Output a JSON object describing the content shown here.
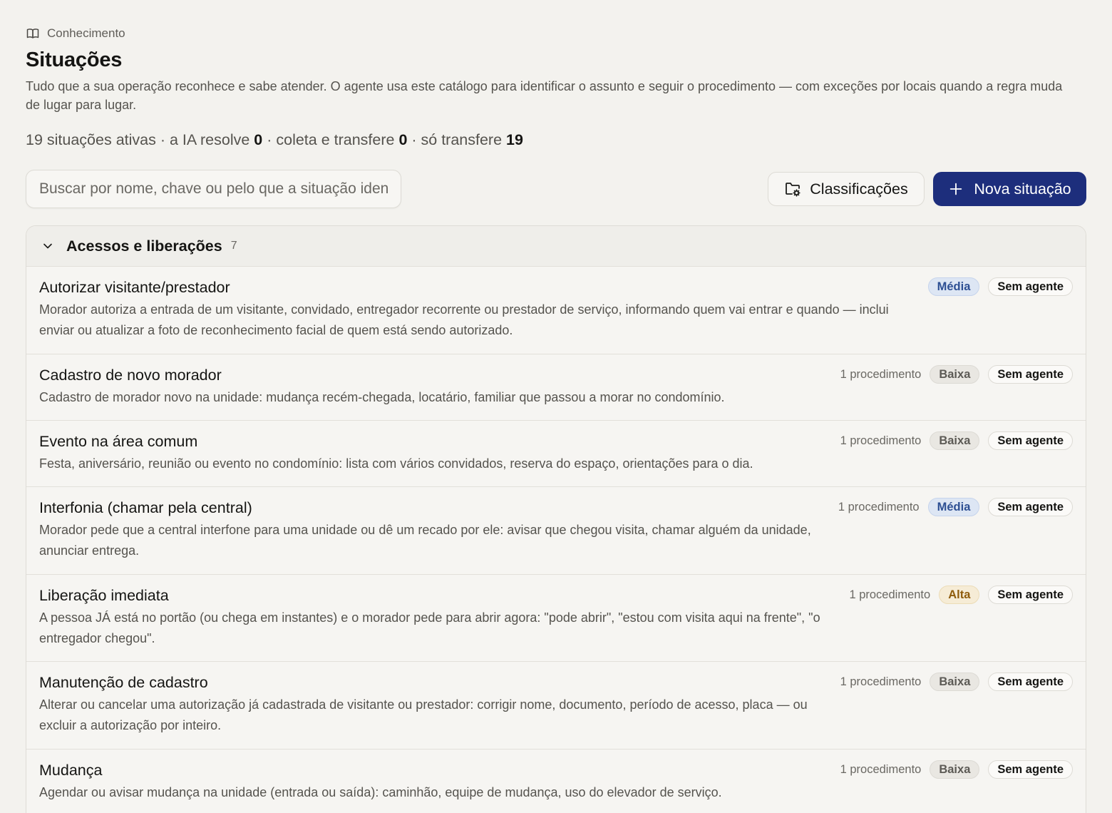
{
  "breadcrumb": {
    "label": "Conhecimento",
    "icon": "book-icon"
  },
  "page": {
    "title": "Situações",
    "description": "Tudo que a sua operação reconhece e sabe atender. O agente usa este catálogo para identificar o assunto e seguir o procedimento — com exceções por locais quando a regra muda de lugar para lugar."
  },
  "stats": {
    "active": "19 situações ativas",
    "sep1": " · a IA resolve ",
    "ia_resolve": "0",
    "sep2": " · coleta e transfere ",
    "coleta_transfere": "0",
    "sep3": " · só transfere ",
    "so_transfere": "19"
  },
  "search": {
    "placeholder": "Buscar por nome, chave ou pelo que a situação identifica",
    "value": ""
  },
  "toolbar": {
    "classificacoes_label": "Classificações",
    "nova_label": "Nova situação"
  },
  "colors": {
    "primary": "#1d2e7c",
    "background": "#f3f2ee",
    "media": "#2d4f93",
    "alta": "#8f5c0c"
  },
  "group": {
    "title": "Acessos e liberações",
    "count": "7",
    "items": [
      {
        "title": "Autorizar visitante/prestador",
        "description": "Morador autoriza a entrada de um visitante, convidado, entregador recorrente ou prestador de serviço, informando quem vai entrar e quando — inclui enviar ou atualizar a foto de reconhecimento facial de quem está sendo autorizado.",
        "procedures": "",
        "priority": "Média",
        "agent": "Sem agente"
      },
      {
        "title": "Cadastro de novo morador",
        "description": "Cadastro de morador novo na unidade: mudança recém-chegada, locatário, familiar que passou a morar no condomínio.",
        "procedures": "1 procedimento",
        "priority": "Baixa",
        "agent": "Sem agente"
      },
      {
        "title": "Evento na área comum",
        "description": "Festa, aniversário, reunião ou evento no condomínio: lista com vários convidados, reserva do espaço, orientações para o dia.",
        "procedures": "1 procedimento",
        "priority": "Baixa",
        "agent": "Sem agente"
      },
      {
        "title": "Interfonia (chamar pela central)",
        "description": "Morador pede que a central interfone para uma unidade ou dê um recado por ele: avisar que chegou visita, chamar alguém da unidade, anunciar entrega.",
        "procedures": "1 procedimento",
        "priority": "Média",
        "agent": "Sem agente"
      },
      {
        "title": "Liberação imediata",
        "description": "A pessoa JÁ está no portão (ou chega em instantes) e o morador pede para abrir agora: \"pode abrir\", \"estou com visita aqui na frente\", \"o entregador chegou\".",
        "procedures": "1 procedimento",
        "priority": "Alta",
        "agent": "Sem agente"
      },
      {
        "title": "Manutenção de cadastro",
        "description": "Alterar ou cancelar uma autorização já cadastrada de visitante ou prestador: corrigir nome, documento, período de acesso, placa — ou excluir a autorização por inteiro.",
        "procedures": "1 procedimento",
        "priority": "Baixa",
        "agent": "Sem agente"
      },
      {
        "title": "Mudança",
        "description": "Agendar ou avisar mudança na unidade (entrada ou saída): caminhão, equipe de mudança, uso do elevador de serviço.",
        "procedures": "1 procedimento",
        "priority": "Baixa",
        "agent": "Sem agente"
      }
    ]
  }
}
